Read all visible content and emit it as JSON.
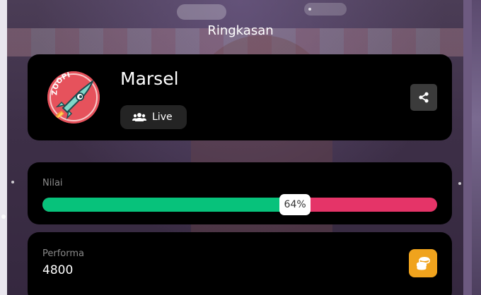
{
  "header": {
    "title": "Ringkasan"
  },
  "profile": {
    "name": "Marsel",
    "avatar_icon": "zoopi-rocket-logo",
    "avatar_logo_text": "ZOOPI",
    "mode_icon": "users-icon",
    "mode_label": "Live",
    "share_icon": "share-icon"
  },
  "score": {
    "label": "Nilai",
    "percent": 64,
    "percent_text": "64%",
    "fill_color": "#07c27b",
    "rest_color": "#e53468"
  },
  "performance": {
    "label": "Performa",
    "value": "4800",
    "icon": "coins-icon",
    "icon_color": "#f0a31d"
  }
}
